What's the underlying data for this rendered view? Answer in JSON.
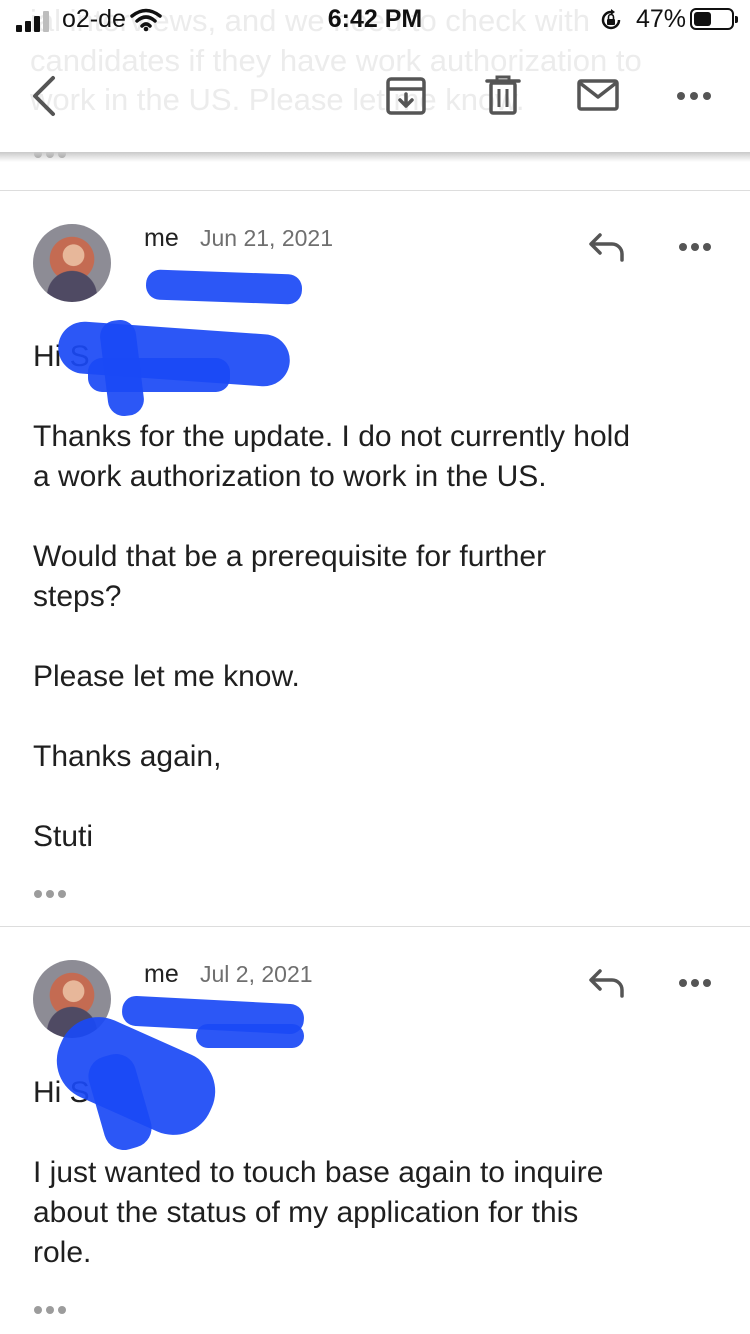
{
  "status_bar": {
    "carrier": "o2-de",
    "time": "6:42 PM",
    "battery_percent": "47%",
    "battery_level": 0.47,
    "icons": [
      "signal-icon",
      "wifi-icon",
      "orientation-lock-icon",
      "battery-icon"
    ]
  },
  "background_text": {
    "line1": "ial interviews, and we need to check with",
    "line2": "candidates if they have work authorization to",
    "line3": "work in the US. Please let me know."
  },
  "toolbar": {
    "icons": [
      "back-chevron-icon",
      "archive-icon",
      "trash-icon",
      "mail-icon",
      "more-horizontal-icon"
    ]
  },
  "messages": [
    {
      "sender": "me",
      "date": "Jun 21, 2021",
      "greeting": "Hi S",
      "lines": [
        "Thanks for the update. I do not currently hold",
        "a work authorization to work in the US.",
        "Would that be a prerequisite for further",
        "steps?",
        "Please let me know.",
        "Thanks again,",
        "Stuti"
      ]
    },
    {
      "sender": "me",
      "date": "Jul 2, 2021",
      "greeting": "Hi S",
      "lines": [
        "I just wanted to touch base again to inquire",
        "about the status of my application for this",
        "role."
      ]
    }
  ],
  "colors": {
    "redaction": "#1a49f5",
    "text": "#1f1f1f",
    "secondary_text": "#6f6f6f",
    "icon": "#555555"
  }
}
